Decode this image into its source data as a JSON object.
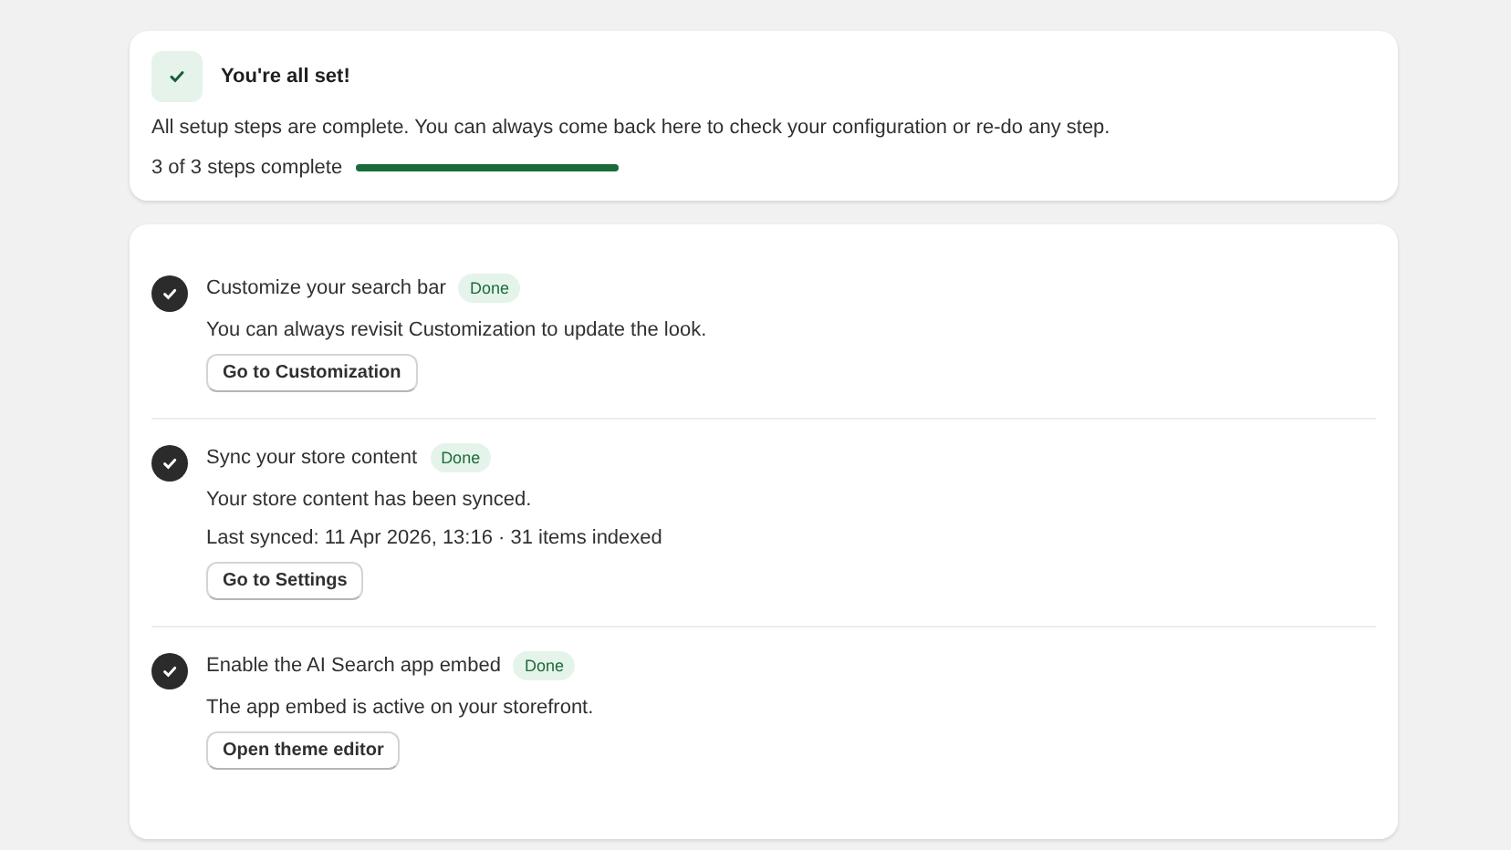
{
  "summary": {
    "title": "You're all set!",
    "done": true,
    "message": "All setup steps are complete. You can always come back here to check your configuration or re-do any step.",
    "progress_label": "3 of 3 steps complete",
    "level": 1
  },
  "steps": [
    {
      "title": "Customize your search bar",
      "completed": true,
      "badge": "Done",
      "lines": [
        "You can always revisit Customization to update the look."
      ],
      "button": "Go to Customization"
    },
    {
      "title": "Sync your store content",
      "completed": true,
      "badge": "Done",
      "lines": [
        "Your store content has been synced.",
        "Last synced: 11 Apr 2026, 13:16 · 31 items indexed"
      ],
      "button": "Go to Settings"
    },
    {
      "title": "Enable the AI Search app embed",
      "completed": true,
      "badge": "Done",
      "lines": [
        "The app embed is active on your storefront."
      ],
      "button": "Open theme editor"
    }
  ]
}
